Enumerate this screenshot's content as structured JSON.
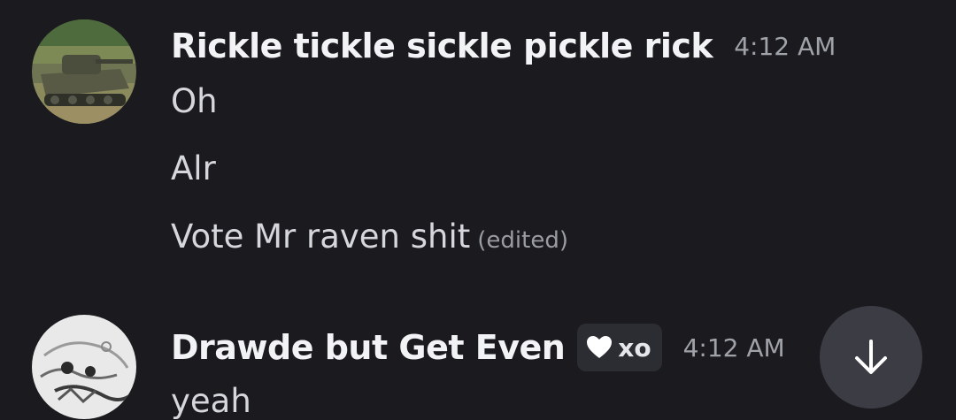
{
  "messages": [
    {
      "author": "Rickle tickle sickle pickle rick",
      "time": "4:12 AM",
      "avatar_icon": "tank-avatar",
      "lines": [
        "Oh",
        "Alr",
        "Vote Mr raven shit"
      ],
      "edited_label": "(edited)"
    },
    {
      "author": "Drawde but Get Even",
      "time": "4:12 AM",
      "avatar_icon": "sketch-avatar",
      "tag": {
        "icon": "white-heart-icon",
        "label": "xo"
      },
      "lines": [
        "yeah"
      ]
    }
  ],
  "scroll_button": {
    "icon": "arrow-down-icon"
  },
  "colors": {
    "background": "#1b1b1f",
    "username": "#f2f3f5",
    "message_text": "#d6d7dc",
    "timestamp": "#a0a2aa",
    "tag_bg": "#2c2d33",
    "scroll_button_bg": "#3c3d44"
  }
}
